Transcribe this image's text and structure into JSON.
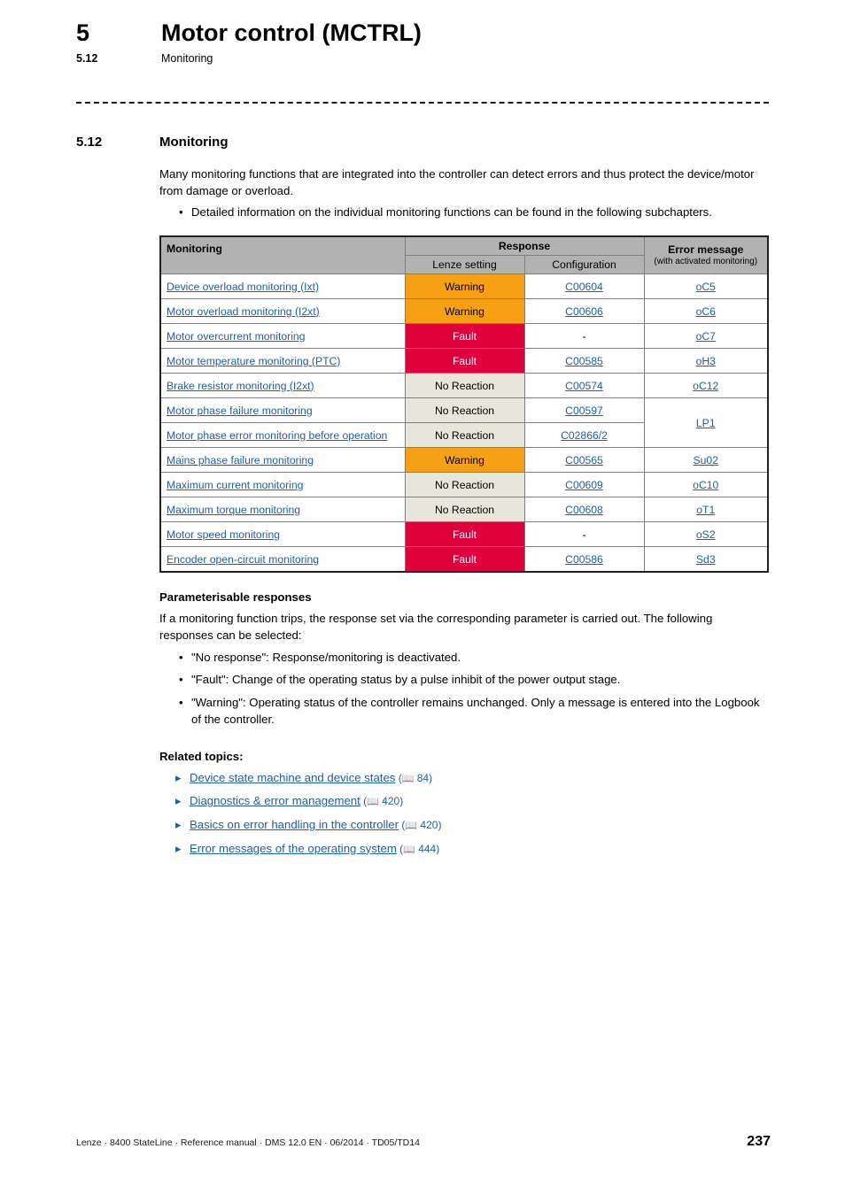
{
  "header": {
    "chapter_number": "5",
    "chapter_title": "Motor control (MCTRL)",
    "subchapter_number": "5.12",
    "subchapter_title": "Monitoring"
  },
  "section": {
    "number": "5.12",
    "title": "Monitoring",
    "intro_paragraph": "Many monitoring functions that are integrated into the controller can detect errors and thus protect the device/motor from damage or overload.",
    "intro_bullets": [
      "Detailed information on the individual monitoring functions can be found in the following subchapters."
    ]
  },
  "table": {
    "headers": {
      "monitoring": "Monitoring",
      "response": "Response",
      "lenze_setting": "Lenze setting",
      "configuration": "Configuration",
      "error_message": "Error message",
      "error_message_note": "(with activated monitoring)"
    },
    "rows": [
      {
        "name": "Device overload monitoring (Ixt)",
        "lenze_setting": "Warning",
        "response_type": "warning",
        "configuration": "C00604",
        "config_is_link": true,
        "error_message": "oC5",
        "error_is_link": true
      },
      {
        "name": "Motor overload monitoring (I2xt)",
        "lenze_setting": "Warning",
        "response_type": "warning",
        "configuration": "C00606",
        "config_is_link": true,
        "error_message": "oC6",
        "error_is_link": true
      },
      {
        "name": "Motor overcurrent monitoring",
        "lenze_setting": "Fault",
        "response_type": "fault",
        "configuration": "-",
        "config_is_link": false,
        "error_message": "oC7",
        "error_is_link": true
      },
      {
        "name": "Motor temperature monitoring (PTC)",
        "lenze_setting": "Fault",
        "response_type": "fault",
        "configuration": "C00585",
        "config_is_link": true,
        "error_message": "oH3",
        "error_is_link": true
      },
      {
        "name": "Brake resistor monitoring (I2xt)",
        "lenze_setting": "No Reaction",
        "response_type": "none",
        "configuration": "C00574",
        "config_is_link": true,
        "error_message": "oC12",
        "error_is_link": true
      },
      {
        "name": "Motor phase failure monitoring",
        "lenze_setting": "No Reaction",
        "response_type": "none",
        "configuration": "C00597",
        "config_is_link": true,
        "error_message": "LP1",
        "error_is_link": true,
        "error_rowspan": 2
      },
      {
        "name": "Motor phase error monitoring before operation",
        "lenze_setting": "No Reaction",
        "response_type": "none",
        "configuration": "C02866/2",
        "config_is_link": true,
        "error_message": "",
        "error_is_link": false,
        "error_skip": true
      },
      {
        "name": "Mains phase failure monitoring",
        "lenze_setting": "Warning",
        "response_type": "warning",
        "configuration": "C00565",
        "config_is_link": true,
        "error_message": "Su02",
        "error_is_link": true
      },
      {
        "name": "Maximum current monitoring",
        "lenze_setting": "No Reaction",
        "response_type": "none",
        "configuration": "C00609",
        "config_is_link": true,
        "error_message": "oC10",
        "error_is_link": true
      },
      {
        "name": "Maximum torque monitoring",
        "lenze_setting": "No Reaction",
        "response_type": "none",
        "configuration": "C00608",
        "config_is_link": true,
        "error_message": "oT1",
        "error_is_link": true
      },
      {
        "name": "Motor speed monitoring",
        "lenze_setting": "Fault",
        "response_type": "fault",
        "configuration": "-",
        "config_is_link": false,
        "error_message": "oS2",
        "error_is_link": true
      },
      {
        "name": "Encoder open-circuit monitoring",
        "lenze_setting": "Fault",
        "response_type": "fault",
        "configuration": "C00586",
        "config_is_link": true,
        "error_message": "Sd3",
        "error_is_link": true
      }
    ]
  },
  "parameterisable": {
    "heading": "Parameterisable responses",
    "paragraph": "If a monitoring function trips, the response set via the corresponding parameter is carried out. The following responses can be selected:",
    "bullets": [
      "\"No response\": Response/monitoring is deactivated.",
      "\"Fault\": Change of the operating status by a pulse inhibit of the power output stage.",
      "\"Warning\": Operating status of the controller remains unchanged. Only a message is entered into the Logbook of the controller."
    ]
  },
  "related_topics": {
    "heading": "Related topics:",
    "items": [
      {
        "label": "Device state machine and device states",
        "page": "84",
        "icon": "book-icon"
      },
      {
        "label": "Diagnostics & error management",
        "page": "420",
        "icon": "book-icon"
      },
      {
        "label": "Basics on error handling in the controller",
        "page": "420",
        "icon": "book-icon"
      },
      {
        "label": "Error messages of the operating system",
        "page": "444",
        "icon": "book-icon"
      }
    ]
  },
  "footer": {
    "text": "Lenze · 8400 StateLine · Reference manual · DMS 12.0 EN · 06/2014 · TD05/TD14",
    "page_number": "237"
  },
  "colors": {
    "warning": "#F7A013",
    "fault": "#E2003C",
    "no_reaction": "#E8E5DA",
    "header_gray": "#B2B2B2",
    "link_blue": "#1F5FA9"
  }
}
